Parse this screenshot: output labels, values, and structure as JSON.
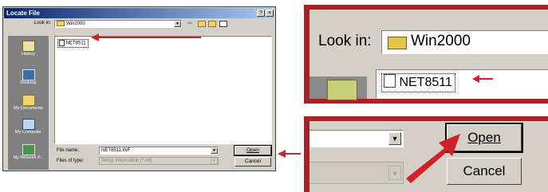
{
  "dialog": {
    "title": "Locate File",
    "title_buttons": [
      "?",
      "×"
    ],
    "look_in_label": "Look in:",
    "look_in_value": "Win2000",
    "file_items": [
      "NET8511"
    ],
    "file_name_label": "File name:",
    "file_name_value": "NET8511.INF",
    "files_of_type_label": "Files of type:",
    "files_of_type_value": "Setup Information (*.inf)",
    "open_label": "Open",
    "cancel_label": "Cancel",
    "places": [
      {
        "label": "History",
        "icon": "history-icon"
      },
      {
        "label": "Desktop",
        "icon": "desktop-icon"
      },
      {
        "label": "My Documents",
        "icon": "my-documents-icon"
      },
      {
        "label": "My Computer",
        "icon": "my-computer-icon"
      },
      {
        "label": "My Network P...",
        "icon": "network-places-icon"
      }
    ]
  },
  "zoom_look_in": {
    "look_in_label": "Look in:",
    "look_in_value": "Win2000",
    "file_item": "NET8511"
  },
  "zoom_buttons": {
    "open_label": "Open",
    "cancel_label": "Cancel"
  },
  "colors": {
    "accent_red": "#d0202a",
    "title_blue": "#0a246a",
    "dialog_gray": "#d4d0c8"
  }
}
